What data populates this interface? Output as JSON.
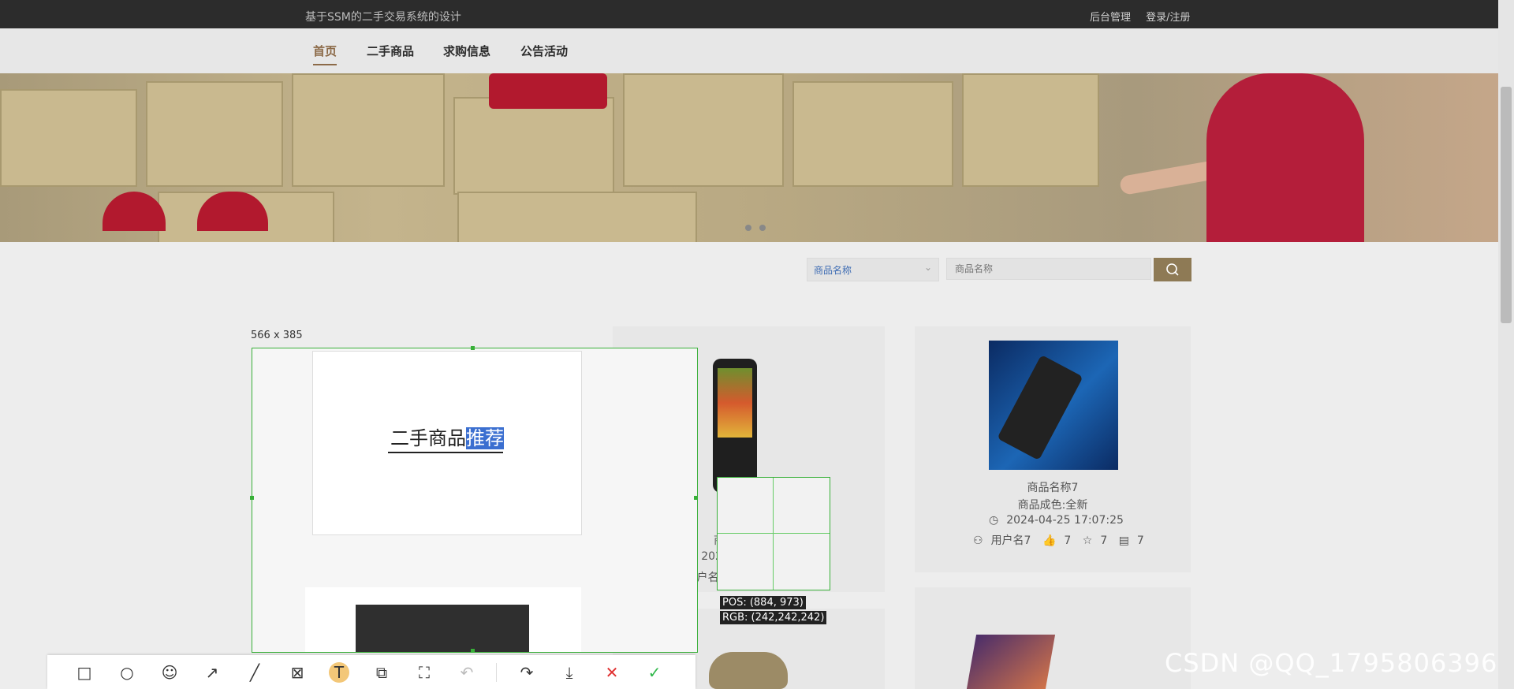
{
  "header": {
    "site_title": "基于SSM的二手交易系统的设计",
    "admin_link": "后台管理",
    "login_link": "登录/注册"
  },
  "nav": [
    "首页",
    "二手商品",
    "求购信息",
    "公告活动"
  ],
  "search": {
    "select_value": "商品名称",
    "input_placeholder": "商品名称"
  },
  "products": [
    {
      "name": "商品名称7",
      "condition": "商品成色:全新",
      "date": "2024-04-25 17:07:25",
      "user": "用户名7",
      "likes": "7",
      "favorites": "7",
      "comments": "7"
    }
  ],
  "partial_card": {
    "name_prefix": "商",
    "date_prefix": "202",
    "user_prefix": "用户名"
  },
  "screenshot_overlay": {
    "size": "566 x 385",
    "recommend_title_main": "二手商品",
    "recommend_title_highlight": "推荐",
    "pos": "POS:  (884, 973)",
    "rgb": "RGB:  (242,242,242)"
  },
  "toolbar_icons": [
    "rectangle-icon",
    "ellipse-icon",
    "emoji-icon",
    "arrow-icon",
    "pen-icon",
    "mosaic-icon",
    "text-icon",
    "copy-icon",
    "ocr-icon",
    "undo-icon",
    "share-icon",
    "download-icon",
    "cancel-icon",
    "confirm-icon"
  ],
  "watermark": "CSDN @QQ_1795806396"
}
